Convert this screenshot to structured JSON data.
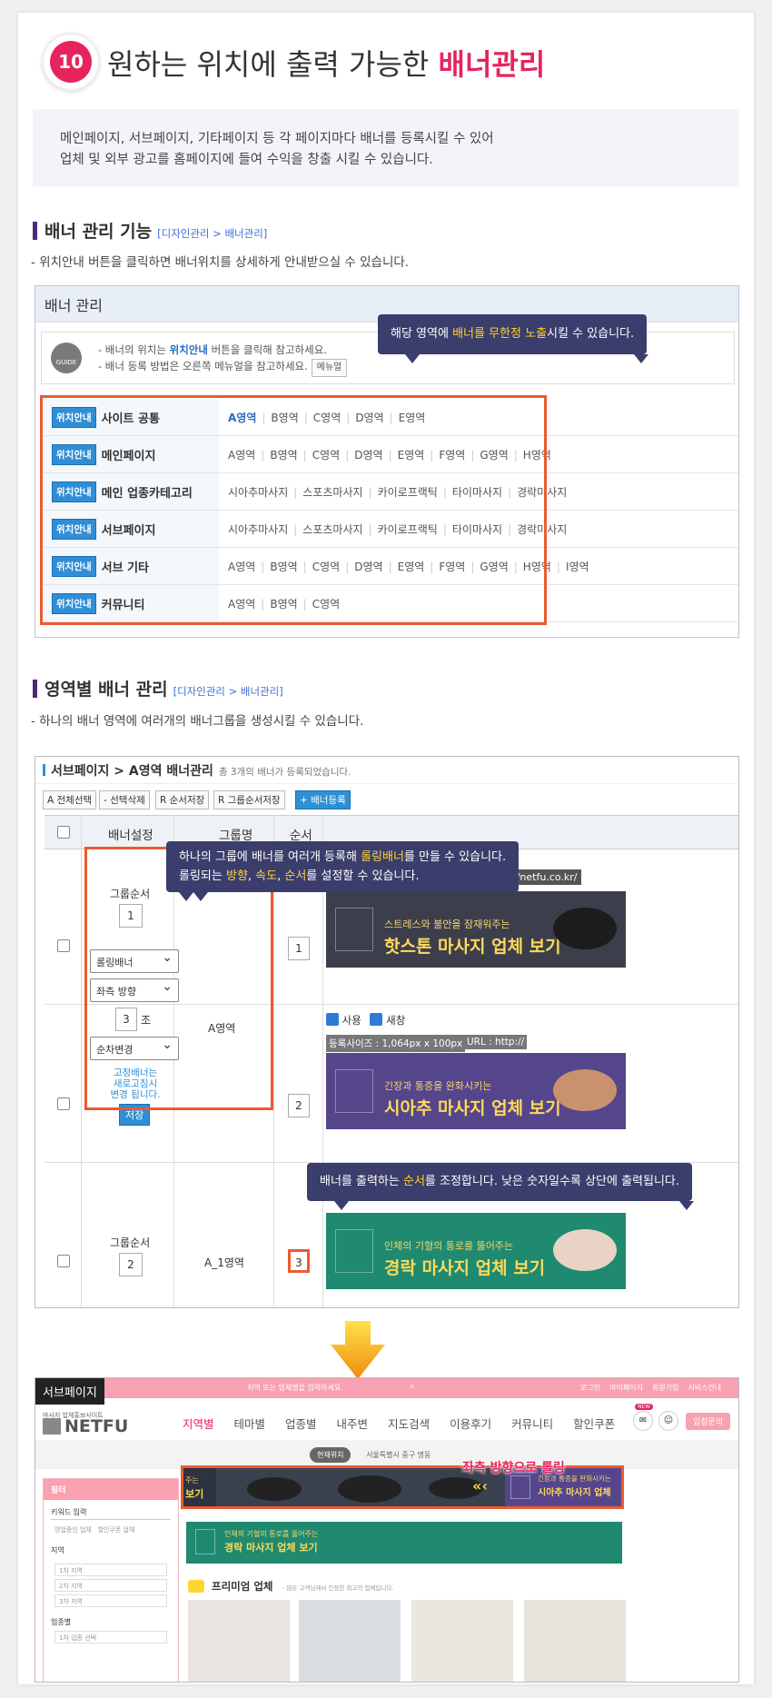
{
  "header": {
    "number": "10",
    "title": "원하는 위치에 출력 가능한",
    "title_accent": "배너관리"
  },
  "intro": {
    "line1": "메인페이지, 서브페이지, 기타페이지 등 각 페이지마다 배너를 등록시킬 수 있어",
    "line2": "업체 및 외부 광고를 홈페이지에 들여 수익을 창출 시킬 수 있습니다."
  },
  "section1": {
    "title": "배너 관리 기능",
    "path": "[디자인관리 > 배너관리]",
    "desc": "- 위치안내 버튼을 클릭하면 배너위치를 상세하게 안내받으실 수 있습니다."
  },
  "banner_mgmt": {
    "panel_title": "배너 관리",
    "guide_icon": "GUIDE",
    "guide_line1_pre": "- 배너의 위치는 ",
    "guide_line1_key": "위치안내",
    "guide_line1_post": " 버튼을 클릭해 참고하세요.",
    "guide_line2": "- 배너 등록 방법은 오른쪽 메뉴얼을 참고하세요.",
    "manual_btn": "메뉴얼",
    "tooltip_pre": "해당 영역에 ",
    "tooltip_key": "배너를 무한정 노출",
    "tooltip_post": "시킬 수 있습니다.",
    "badge": "위치안내",
    "rows": [
      {
        "label": "사이트 공통",
        "areas": [
          "A영역",
          "B영역",
          "C영역",
          "D영역",
          "E영역"
        ]
      },
      {
        "label": "메인페이지",
        "areas": [
          "A영역",
          "B영역",
          "C영역",
          "D영역",
          "E영역",
          "F영역",
          "G영역",
          "H영역"
        ]
      },
      {
        "label": "메인 업종카테고리",
        "areas": [
          "시아추마사지",
          "스포츠마사지",
          "카이로프랙틱",
          "타이마사지",
          "경락마사지"
        ]
      },
      {
        "label": "서브페이지",
        "areas": [
          "시아추마사지",
          "스포츠마사지",
          "카이로프랙틱",
          "타이마사지",
          "경락마사지"
        ]
      },
      {
        "label": "서브 기타",
        "areas": [
          "A영역",
          "B영역",
          "C영역",
          "D영역",
          "E영역",
          "F영역",
          "G영역",
          "H영역",
          "I영역"
        ]
      },
      {
        "label": "커뮤니티",
        "areas": [
          "A영역",
          "B영역",
          "C영역"
        ]
      }
    ]
  },
  "section2": {
    "title": "영역별 배너 관리",
    "path": "[디자인관리 > 배너관리]",
    "desc": "- 하나의 배너 영역에 여러개의 배너그룹을 생성시킬 수 있습니다."
  },
  "area_mgmt": {
    "title": "서브페이지 > A영역 배너관리",
    "count_note": "총 3개의 배너가 등록되었습니다.",
    "toolbar": [
      "A 전체선택",
      "- 선택삭제",
      "R 순서저장",
      "R 그룹순서저장",
      "+ 배너등록"
    ],
    "columns": [
      "배너설정",
      "그룹명",
      "순서"
    ],
    "tooltip1_l1_pre": "하나의 그룹에 배너를 여러개 등록해 ",
    "tooltip1_l1_key": "롤링배너",
    "tooltip1_l1_post": "를 만들 수 있습니다.",
    "tooltip1_l2_pre": "롤링되는 ",
    "tooltip1_l2_k1": "방향",
    "tooltip1_l2_s1": ", ",
    "tooltip1_l2_k2": "속도",
    "tooltip1_l2_s2": ", ",
    "tooltip1_l2_k3": "순서",
    "tooltip1_l2_post": "를 설정할 수 있습니다.",
    "group_order_label": "그룹순서",
    "group1_order": "1",
    "group2_order": "2",
    "rolling_select": "롤링배너",
    "direction_select": "좌측 방향",
    "count_value": "3",
    "count_unit": "조",
    "order_select": "순차변경",
    "note_l1": "고정배너는",
    "note_l2": "새로고침시",
    "note_l3": "변경 됩니다.",
    "save_btn": "저장",
    "group1_name": "A영역",
    "group2_name": "A_1영역",
    "orders": [
      "1",
      "2",
      "3"
    ],
    "url1": "https://netfu.co.kr/",
    "use_label": "사용",
    "newwin_label": "새창",
    "size_label": "등록사이즈 : 1,064px x 100px",
    "url_label": "URL : http://",
    "tooltip2_pre": "배너를 출력하는 ",
    "tooltip2_key": "순서",
    "tooltip2_post": "를 조정합니다. 낮은 숫자일수록 상단에 출력됩니다.",
    "banners": [
      {
        "sub": "스트레스와 불안을 잠재워주는",
        "main": "핫스톤 마사지 업체 보기",
        "color": "#3c3f4b"
      },
      {
        "sub": "긴장과 통증을 완화시키는",
        "main": "시아추 마사지 업체 보기",
        "color": "#55468c"
      },
      {
        "sub": "인체의 기혈의 통로를 뚫어주는",
        "main": "경락 마사지 업체 보기",
        "color": "#1f8a70"
      }
    ]
  },
  "preview": {
    "tag": "서브페이지",
    "search_placeholder": "지역 또는 업체명을 입력하세요.",
    "top_links": [
      "로그인",
      "마이페이지",
      "회원가입",
      "서비스안내"
    ],
    "logo_small": "마사지 업체홍보사이트",
    "logo": "NETFU",
    "nav": [
      "지역별",
      "테마별",
      "업종별",
      "내주변",
      "지도검색",
      "이용후기",
      "커뮤니티",
      "할인쿠폰"
    ],
    "new_badge": "NEW",
    "inquiry_btn": "입점문의",
    "current_badge": "현재위치",
    "current_text": "서울특별시 중구 명동",
    "filter_title": "필터",
    "keyword_label": "키워드 입력",
    "chk1": "영업중인 업체",
    "chk2": "할인쿠폰 업체",
    "region_label": "지역",
    "region_selects": [
      "1차 지역",
      "2차 지역",
      "3차 지역"
    ],
    "category_label": "업종별",
    "category_select": "1차 업종 선택",
    "rolling_label": "좌측 방향으로 롤링",
    "strip_left_sub": "주는",
    "strip_left_main": "보기",
    "strip_right_sub": "긴장과 통증을 완화시키는",
    "strip_right_main": "시아추 마사지 업체",
    "green_sub": "인체의 기혈의 통로를 뚫어주는",
    "green_main": "경락 마사지 업체 보기",
    "premium_title": "프리미엄 업체",
    "premium_note": "- 많은 고객님께서 인정한 최고의 업체입니다."
  }
}
